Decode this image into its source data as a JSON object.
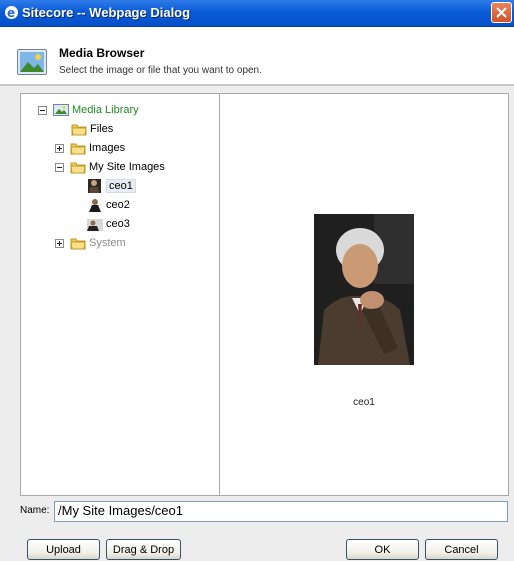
{
  "window": {
    "title": "Sitecore -- Webpage Dialog"
  },
  "header": {
    "title": "Media Browser",
    "subtitle": "Select the image or file that you want to open."
  },
  "tree": {
    "root": "Media Library",
    "files": "Files",
    "images": "Images",
    "my_site_images": "My Site Images",
    "ceo1": "ceo1",
    "ceo2": "ceo2",
    "ceo3": "ceo3",
    "system": "System"
  },
  "preview": {
    "caption": "ceo1"
  },
  "name_field": {
    "label": "Name:",
    "value": "/My Site Images/ceo1"
  },
  "buttons": {
    "upload": "Upload",
    "drag_drop": "Drag & Drop",
    "ok": "OK",
    "cancel": "Cancel"
  }
}
